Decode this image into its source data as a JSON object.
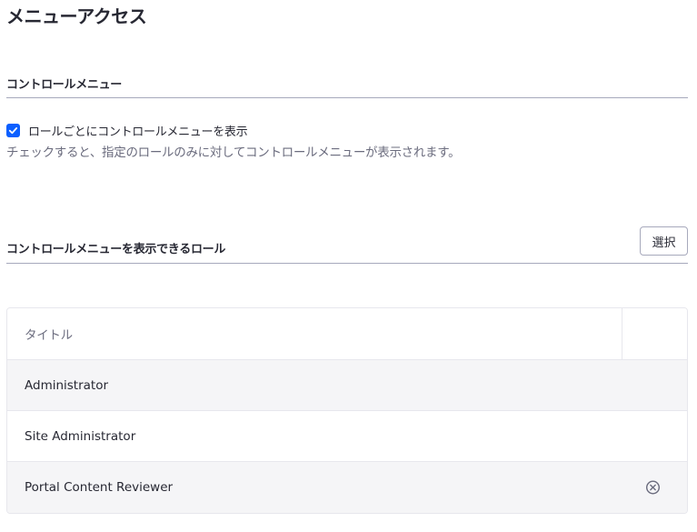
{
  "page": {
    "title": "メニューアクセス"
  },
  "control_menu_section": {
    "title": "コントロールメニュー",
    "checkbox_label": "ロールごとにコントロールメニューを表示",
    "checkbox_checked": true,
    "help_text": "チェックすると、指定のロールのみに対してコントロールメニューが表示されます。"
  },
  "roles_section": {
    "title": "コントロールメニューを表示できるロール",
    "select_button_label": "選択",
    "table": {
      "columns": [
        "タイトル",
        ""
      ],
      "rows": [
        {
          "title": "Administrator"
        },
        {
          "title": "Site Administrator"
        },
        {
          "title": "Portal Content Reviewer"
        }
      ]
    }
  },
  "colors": {
    "accent": "#0b5fff",
    "text": "#272833",
    "muted_text": "#6b6c7e",
    "border": "#e7e7ed",
    "row_shade": "#f5f5f7"
  },
  "icons": {
    "checkbox": "check-icon",
    "row_remove": "times-circle-icon"
  }
}
